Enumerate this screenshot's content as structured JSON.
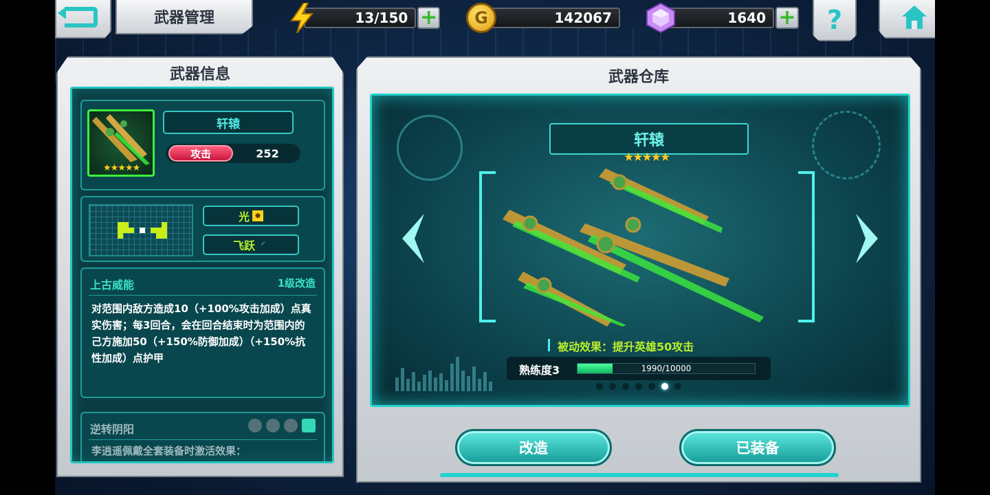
{
  "topbar": {
    "title": "武器管理",
    "energy": "13/150",
    "gold": "142067",
    "gems": "1640",
    "coin_glyph": "G",
    "help_glyph": "?",
    "plus_glyph": "+"
  },
  "left_panel": {
    "title": "武器信息",
    "weapon_name": "轩辕",
    "stars": "★★★★★",
    "attack_label": "攻击",
    "attack_value": "252",
    "element_label": "光",
    "move_label": "飞跃",
    "skill": {
      "name": "上古威能",
      "level": "1级改造",
      "description": "对范围内敌方造成10（+100%攻击加成）点真实伤害；每3回合，会在回合结束时为范围内的己方施加50（+150%防御加成）（+150%抗性加成）点护甲"
    },
    "set_skill": {
      "name": "逆转阴阳",
      "description": "李逍遥佩戴全套装备时激活效果："
    }
  },
  "right_panel": {
    "title": "武器仓库",
    "weapon_name": "轩辕",
    "stars": "★★★★★",
    "passive": "被动效果：提升英雄50攻击",
    "proficiency_label": "熟练度3",
    "proficiency_text": "1990/10000",
    "proficiency_fraction": 0.199,
    "page_count": 7,
    "current_page": 6
  },
  "buttons": {
    "upgrade": "改造",
    "equipped": "已装备"
  },
  "colors": {
    "accent_teal": "#25d4cc",
    "attack_red": "#c8163e",
    "highlight_green": "#b9f02a",
    "star_gold": "#ffcc22"
  },
  "icons": {
    "back": "back-arrow-icon",
    "energy": "lightning-icon",
    "gold": "gold-coin-icon",
    "gem": "gem-icon",
    "help": "help-icon",
    "home": "home-icon"
  }
}
